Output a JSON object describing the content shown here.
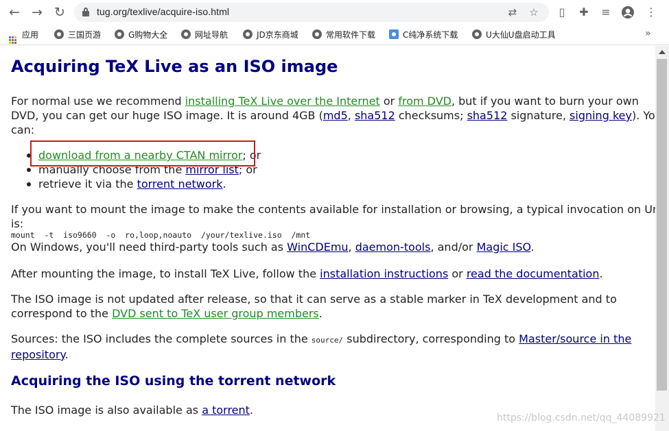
{
  "browser": {
    "url": "tug.org/texlive/acquire-iso.html",
    "nav_icons": [
      "back-arrow-icon",
      "forward-arrow-icon",
      "reload-icon"
    ],
    "omnibox_icons": [
      "translate-icon",
      "bookmark-star-icon"
    ],
    "toolbar_icons": [
      "reader-mode-icon",
      "extensions-puzzle-icon",
      "media-queue-icon",
      "profile-icon",
      "menu-dots-icon"
    ],
    "bookmarks": {
      "apps_label": "应用",
      "items": [
        "三国页游",
        "G购物大全",
        "网址导航",
        "JD京东商城",
        "常用软件下载",
        "C纯净系统下载",
        "U大仙U盘启动工具"
      ],
      "more": "»"
    }
  },
  "page": {
    "title": "Acquiring TeX Live as an ISO image",
    "intro": {
      "t1": "For normal use we recommend ",
      "link_internet": "installing TeX Live over the Internet",
      "t2": " or ",
      "link_dvd": "from DVD",
      "t3": ", but if you want to burn your own",
      "t4": "DVD, you can get our huge ISO image. It is around 4GB (",
      "link_md5": "md5",
      "t5": ", ",
      "link_sha512": "sha512",
      "t6": " checksums; ",
      "link_sha512_sig": "sha512",
      "t7": " signature, ",
      "link_signing_key": "signing key",
      "t8": "). You",
      "t9": "can:"
    },
    "options": [
      {
        "link": "download from a nearby CTAN mirror",
        "after": "; or"
      },
      {
        "before": "manually choose from the ",
        "link": "mirror list",
        "after": "; or"
      },
      {
        "before": "retrieve it via the ",
        "link": "torrent network",
        "after": "."
      }
    ],
    "mount": {
      "t1": "If you want to mount the image to make the contents available for installation or browsing, a typical invocation on Unix",
      "t2": "is:",
      "command": "mount  -t  iso9660  -o  ro,loop,noauto  /your/texlive.iso  /mnt",
      "win_before": "On Windows, you'll need third-party tools such as ",
      "link_wincdemu": "WinCDEmu",
      "sep1": ", ",
      "link_daemon": "daemon-tools",
      "sep2": ", and/or ",
      "link_magiciso": "Magic ISO",
      "end": "."
    },
    "after_mount": {
      "before": "After mounting the image, to install TeX Live, follow the ",
      "link_instructions": "installation instructions",
      "mid": " or ",
      "link_docs": "read the documentation",
      "end": "."
    },
    "not_updated": {
      "t1": "The ISO image is not updated after release, so that it can serve as a stable marker in TeX development and to",
      "t2": "correspond to the ",
      "link_dvd_sent": "DVD sent to TeX user group members",
      "end": "."
    },
    "sources": {
      "t1": "Sources: the ISO includes the complete sources in the ",
      "code": "source/",
      "t2": " subdirectory, corresponding to ",
      "link_master": "Master/source in the",
      "link_repo": "repository",
      "end": "."
    },
    "torrent_heading": "Acquiring the ISO using the torrent network",
    "torrent": {
      "before": "The ISO image is also available as ",
      "link": "a torrent",
      "end": "."
    },
    "watermark": "https://blog.csdn.net/qq_44089921"
  },
  "colors": {
    "heading": "#000080",
    "link": "#000080",
    "visited_link": "#228b22",
    "highlight_box": "#d0181b"
  }
}
